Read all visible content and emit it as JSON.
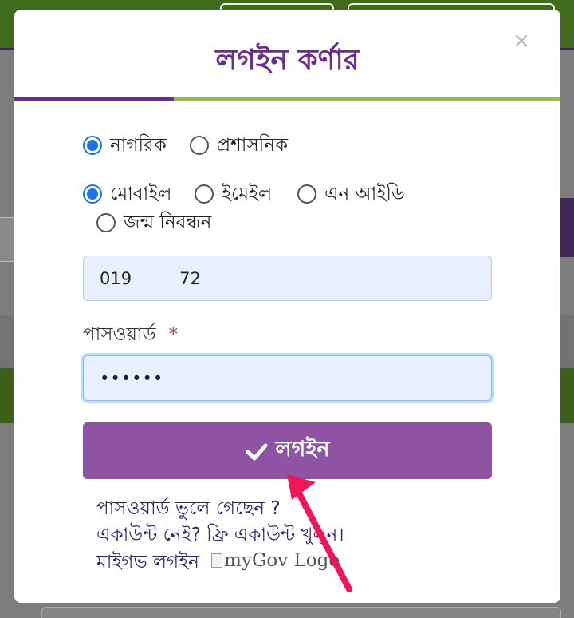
{
  "modal": {
    "title": "লগইন কর্ণার",
    "close_label": "×"
  },
  "user_type": {
    "options": [
      {
        "label": "নাগরিক",
        "checked": true
      },
      {
        "label": "প্রশাসনিক",
        "checked": false
      }
    ]
  },
  "login_method": {
    "options": [
      {
        "label": "মোবাইল",
        "checked": true
      },
      {
        "label": "ইমেইল",
        "checked": false
      },
      {
        "label": "এন আইডি",
        "checked": false
      },
      {
        "label": "জন্ম নিবন্ধন",
        "checked": false
      }
    ]
  },
  "mobile_field": {
    "value": "019         72"
  },
  "password_field": {
    "label": "পাসওয়ার্ড",
    "required_mark": "*",
    "value": "••••••"
  },
  "login_button": {
    "label": "লগইন",
    "icon": "check-icon"
  },
  "links": {
    "forgot_password": "পাসওয়ার্ড ভুলে গেছেন ?",
    "no_account": "একাউন্ট নেই? ফ্রি একাউন্ট খুলুন।",
    "mygov_login": "মাইগভ লগইন",
    "mygov_logo_alt": "myGov Logo"
  },
  "colors": {
    "title": "#6a2c91",
    "button": "#8e54a3",
    "radio_checked": "#1a73e8",
    "annotation_arrow": "#f0145a"
  }
}
